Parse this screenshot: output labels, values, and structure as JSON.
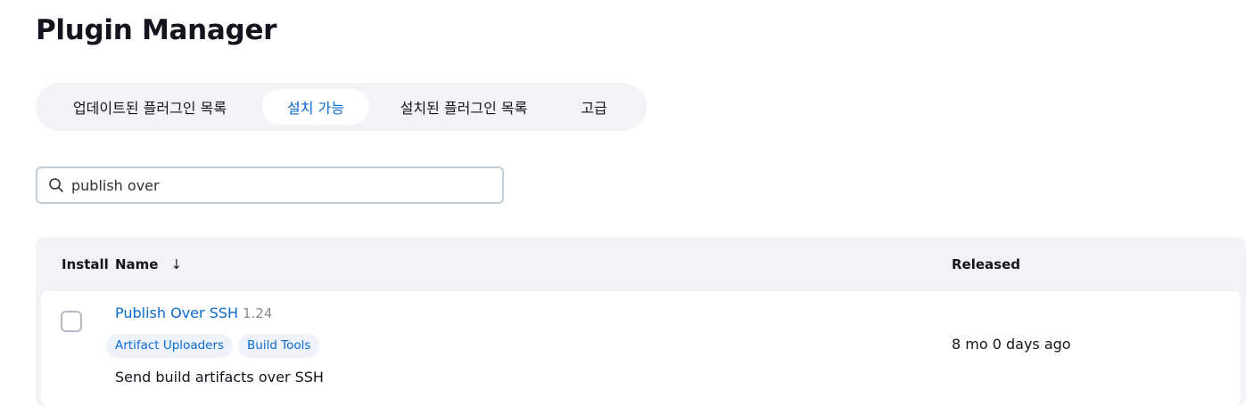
{
  "page": {
    "title": "Plugin Manager"
  },
  "tabs": [
    {
      "label": "업데이트된 플러그인 목록",
      "active": false
    },
    {
      "label": "설치 가능",
      "active": true
    },
    {
      "label": "설치된 플러그인 목록",
      "active": false
    },
    {
      "label": "고급",
      "active": false
    }
  ],
  "search": {
    "icon": "search-icon",
    "value": "publish over"
  },
  "table": {
    "headers": {
      "install": "Install",
      "name": "Name",
      "sort_indicator": "↓",
      "released": "Released"
    },
    "rows": [
      {
        "name": "Publish Over SSH",
        "version": "1.24",
        "tags": [
          "Artifact Uploaders",
          "Build Tools"
        ],
        "description": "Send build artifacts over SSH",
        "released": "8 mo 0 days ago",
        "checked": false
      }
    ]
  },
  "colors": {
    "accent": "#0b6ad2",
    "panel": "#f2f2f7",
    "text": "#14141f"
  }
}
